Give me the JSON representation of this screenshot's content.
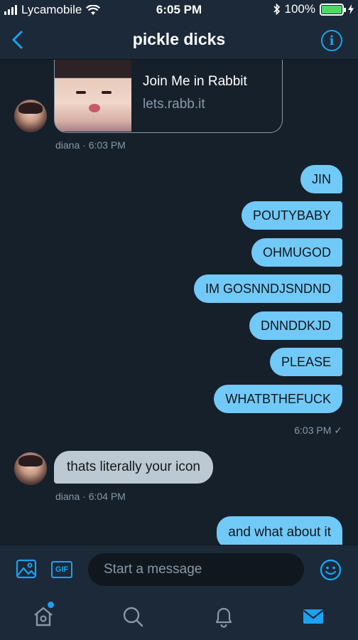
{
  "status_bar": {
    "carrier": "Lycamobile",
    "time": "6:05 PM",
    "battery": "100%",
    "battery_fraction": 1.0
  },
  "header": {
    "title": "pickle dicks",
    "back_icon": "chevron-left-icon",
    "info_icon": "info-icon"
  },
  "card": {
    "title": "Join Me in Rabbit",
    "url": "lets.rabb.it",
    "meta": "diana · 6:03 PM"
  },
  "outgoing": [
    {
      "text": "JIN"
    },
    {
      "text": "POUTYBABY"
    },
    {
      "text": "OHMUGOD"
    },
    {
      "text": "IM GOSNNDJSNDND"
    },
    {
      "text": "DNNDDKJD"
    },
    {
      "text": "PLEASE"
    },
    {
      "text": "WHATBTHEFUCK"
    }
  ],
  "outgoing_meta": "6:03 PM ✓",
  "incoming": {
    "text": "thats literally your icon",
    "meta": "diana · 6:04 PM"
  },
  "outgoing2": {
    "text": "and what about it"
  },
  "composer": {
    "placeholder": "Start a message",
    "gif_label": "GIF",
    "image_icon": "image-icon",
    "emoji_icon": "emoji-icon"
  },
  "tabs": [
    "home-icon",
    "search-icon",
    "notifications-icon",
    "messages-icon"
  ],
  "colors": {
    "accent": "#1da1f2",
    "outgoing_bubble": "#71c9f8",
    "incoming_bubble": "#bcc9d2",
    "background": "#15202b"
  }
}
